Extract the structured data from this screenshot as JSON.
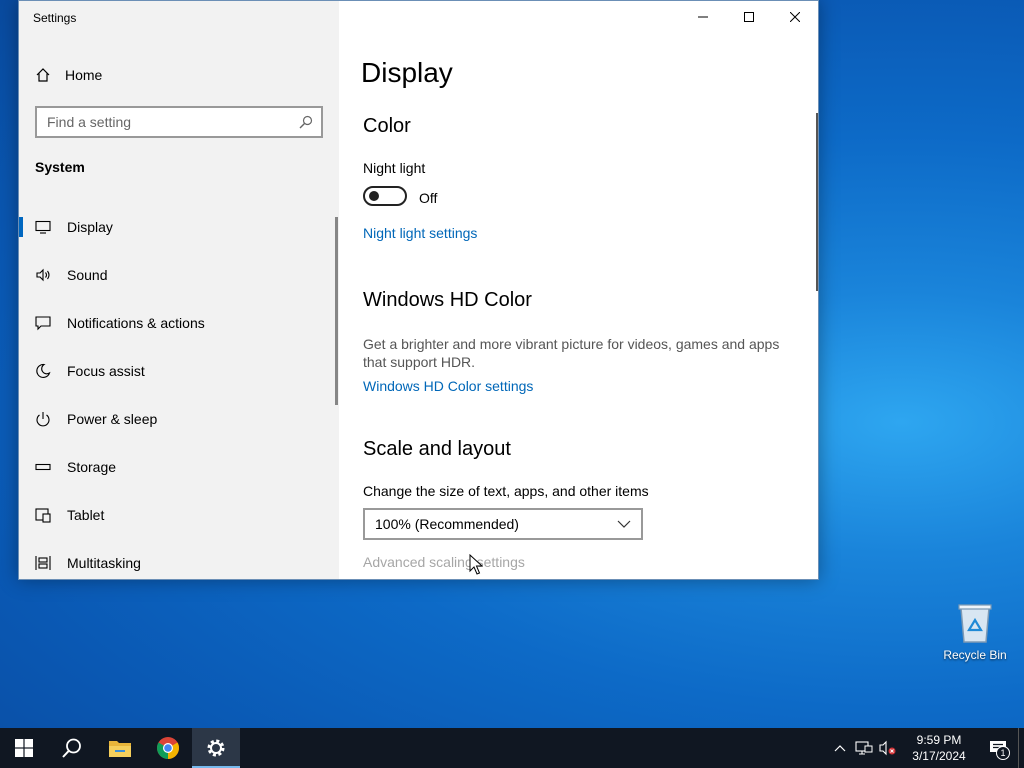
{
  "window": {
    "title": "Settings"
  },
  "sidebar": {
    "home_label": "Home",
    "search_placeholder": "Find a setting",
    "section_label": "System",
    "items": [
      {
        "label": "Display",
        "icon": "monitor-icon",
        "active": true
      },
      {
        "label": "Sound",
        "icon": "speaker-icon"
      },
      {
        "label": "Notifications & actions",
        "icon": "notification-icon"
      },
      {
        "label": "Focus assist",
        "icon": "moon-icon"
      },
      {
        "label": "Power & sleep",
        "icon": "power-icon"
      },
      {
        "label": "Storage",
        "icon": "storage-icon"
      },
      {
        "label": "Tablet",
        "icon": "tablet-icon"
      },
      {
        "label": "Multitasking",
        "icon": "multitasking-icon"
      }
    ]
  },
  "content": {
    "page_title": "Display",
    "color_heading": "Color",
    "night_light_label": "Night light",
    "night_light_state": "Off",
    "night_light_link": "Night light settings",
    "hd_heading": "Windows HD Color",
    "hd_description": "Get a brighter and more vibrant picture for videos, games and apps that support HDR.",
    "hd_link": "Windows HD Color settings",
    "scale_heading": "Scale and layout",
    "scale_label": "Change the size of text, apps, and other items",
    "scale_value": "100% (Recommended)",
    "advanced_link": "Advanced scaling settings"
  },
  "desktop": {
    "recycle_bin_label": "Recycle Bin"
  },
  "taskbar": {
    "time": "9:59 PM",
    "date": "3/17/2024",
    "notification_count": "1"
  },
  "colors": {
    "accent": "#0067c0",
    "link": "#0067b8",
    "taskbar": "#101722"
  }
}
